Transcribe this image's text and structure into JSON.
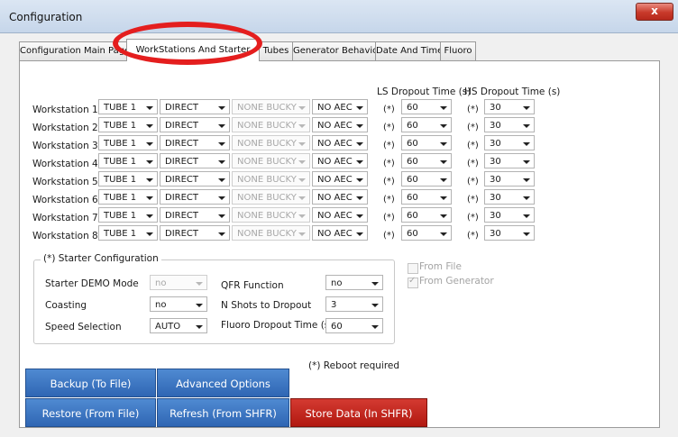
{
  "window": {
    "title": "Configuration",
    "close_label": "x"
  },
  "tabs": [
    {
      "label": "Configuration Main Page"
    },
    {
      "label": "WorkStations And Starter"
    },
    {
      "label": "Tubes"
    },
    {
      "label": "Generator Behavior"
    },
    {
      "label": "Date And Time"
    },
    {
      "label": "Fluoro"
    }
  ],
  "headers": {
    "ls_dropout": "LS Dropout Time (s)",
    "hs_dropout": "HS Dropout Time (s)"
  },
  "workstations": [
    {
      "label": "Workstation 1",
      "tube": "TUBE 1",
      "mode": "DIRECT",
      "bucky": "NONE BUCKY",
      "aec": "NO AEC",
      "ls_mark": "(*)",
      "ls": "60",
      "hs_mark": "(*)",
      "hs": "30"
    },
    {
      "label": "Workstation 2",
      "tube": "TUBE 1",
      "mode": "DIRECT",
      "bucky": "NONE BUCKY",
      "aec": "NO AEC",
      "ls_mark": "(*)",
      "ls": "60",
      "hs_mark": "(*)",
      "hs": "30"
    },
    {
      "label": "Workstation 3",
      "tube": "TUBE 1",
      "mode": "DIRECT",
      "bucky": "NONE BUCKY",
      "aec": "NO AEC",
      "ls_mark": "(*)",
      "ls": "60",
      "hs_mark": "(*)",
      "hs": "30"
    },
    {
      "label": "Workstation 4",
      "tube": "TUBE 1",
      "mode": "DIRECT",
      "bucky": "NONE BUCKY",
      "aec": "NO AEC",
      "ls_mark": "(*)",
      "ls": "60",
      "hs_mark": "(*)",
      "hs": "30"
    },
    {
      "label": "Workstation 5",
      "tube": "TUBE 1",
      "mode": "DIRECT",
      "bucky": "NONE BUCKY",
      "aec": "NO AEC",
      "ls_mark": "(*)",
      "ls": "60",
      "hs_mark": "(*)",
      "hs": "30"
    },
    {
      "label": "Workstation 6",
      "tube": "TUBE 1",
      "mode": "DIRECT",
      "bucky": "NONE BUCKY",
      "aec": "NO AEC",
      "ls_mark": "(*)",
      "ls": "60",
      "hs_mark": "(*)",
      "hs": "30"
    },
    {
      "label": "Workstation 7",
      "tube": "TUBE 1",
      "mode": "DIRECT",
      "bucky": "NONE BUCKY",
      "aec": "NO AEC",
      "ls_mark": "(*)",
      "ls": "60",
      "hs_mark": "(*)",
      "hs": "30"
    },
    {
      "label": "Workstation 8",
      "tube": "TUBE 1",
      "mode": "DIRECT",
      "bucky": "NONE BUCKY",
      "aec": "NO AEC",
      "ls_mark": "(*)",
      "ls": "60",
      "hs_mark": "(*)",
      "hs": "30"
    }
  ],
  "starter": {
    "title": "(*) Starter Configuration",
    "demo_label": "Starter DEMO Mode",
    "demo_value": "no",
    "coasting_label": "Coasting",
    "coasting_value": "no",
    "speed_label": "Speed Selection",
    "speed_value": "AUTO",
    "qfr_label": "QFR Function",
    "qfr_value": "no",
    "nshots_label": "N Shots to Dropout",
    "nshots_value": "3",
    "fluoro_label": "Fluoro Dropout Time (s)",
    "fluoro_value": "60"
  },
  "source": {
    "from_file": "From File",
    "from_generator": "From Generator"
  },
  "reboot_note": "(*) Reboot required",
  "buttons": {
    "backup": "Backup (To File)",
    "advanced": "Advanced Options",
    "restore": "Restore (From File)",
    "refresh": "Refresh (From SHFR)",
    "store": "Store Data (In SHFR)"
  }
}
